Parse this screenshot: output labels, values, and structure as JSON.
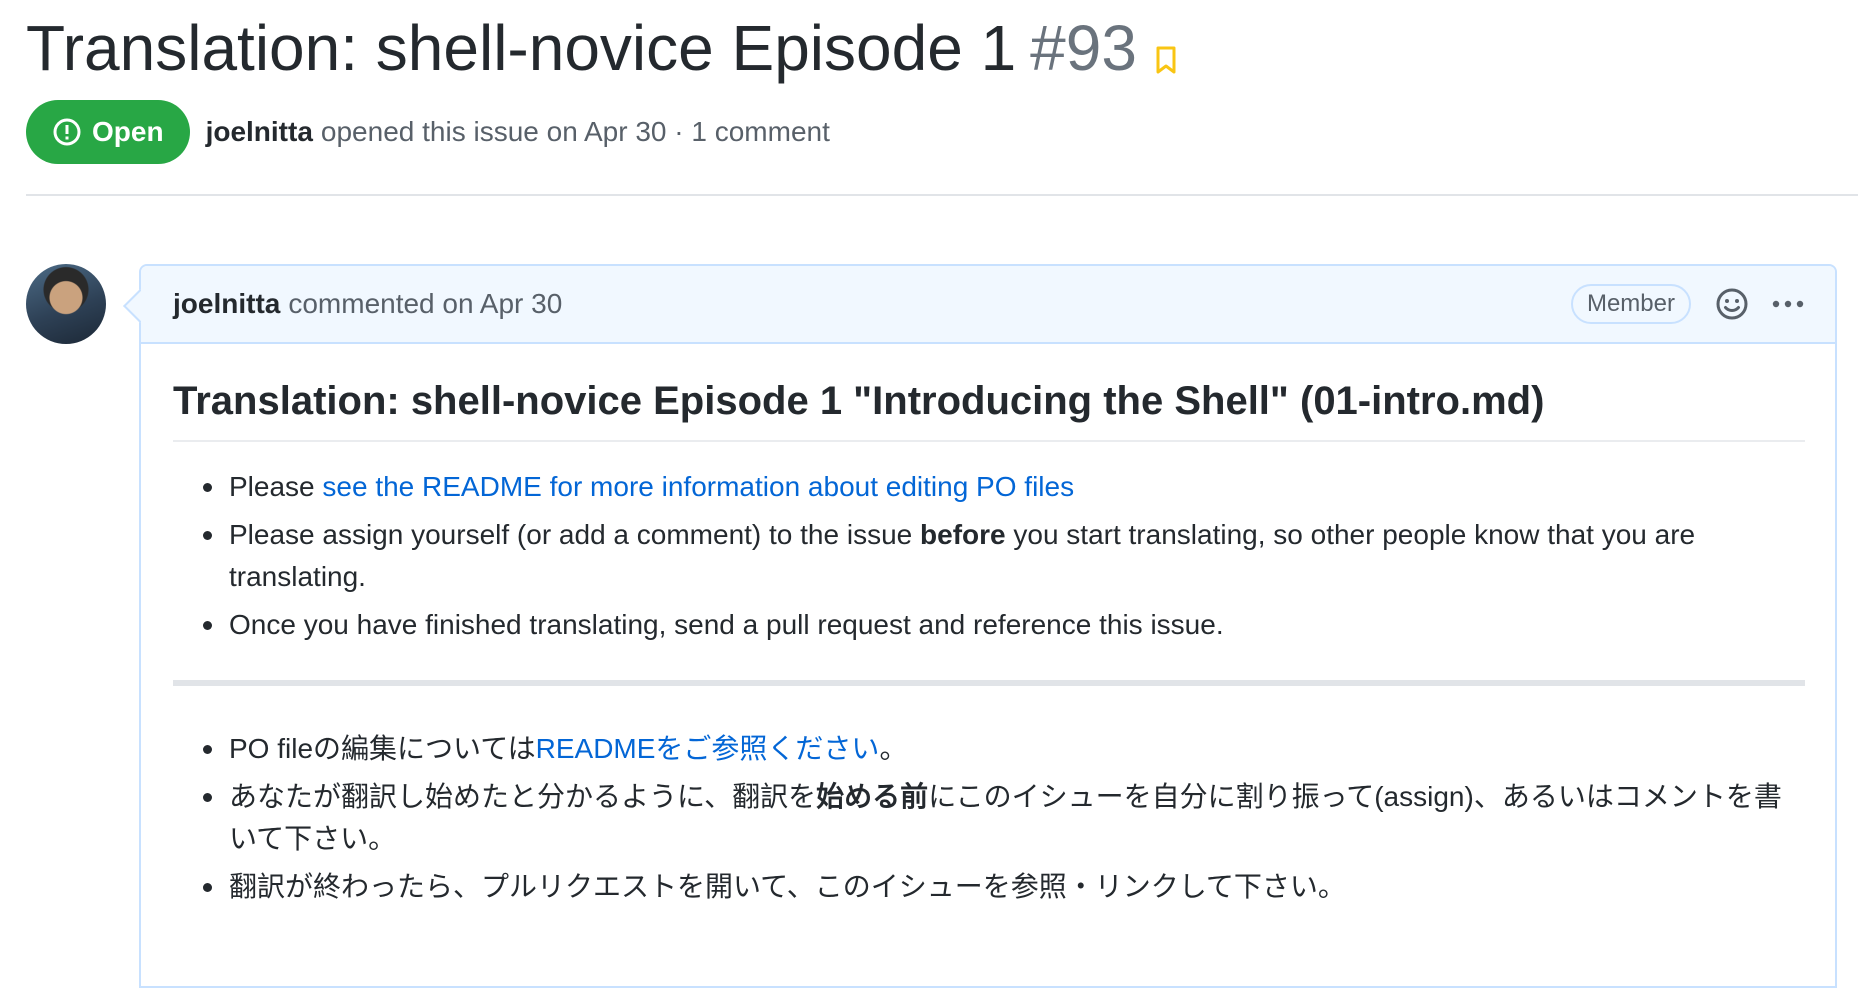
{
  "issue": {
    "title": "Translation: shell-novice Episode 1",
    "number": "#93",
    "state": "Open",
    "author": "joelnitta",
    "meta_text": "opened this issue on Apr 30 · 1 comment"
  },
  "comment": {
    "author": "joelnitta",
    "meta_text": "commented on Apr 30",
    "role": "Member",
    "heading": "Translation: shell-novice Episode 1 \"Introducing the Shell\" (01-intro.md)",
    "en": {
      "item1_prefix": "Please ",
      "item1_link": "see the README for more information about editing PO files",
      "item2_before": "Please assign yourself (or add a comment) to the issue ",
      "item2_bold": "before",
      "item2_after": " you start translating, so other people know that you are translating.",
      "item3": "Once you have finished translating, send a pull request and reference this issue."
    },
    "ja": {
      "item1_prefix": "PO fileの編集については",
      "item1_link": "READMEをご参照ください",
      "item1_suffix": "。",
      "item2_before": "あなたが翻訳し始めたと分かるように、翻訳を",
      "item2_bold": "始める前",
      "item2_after": "にこのイシューを自分に割り振って(assign)、あるいはコメントを書いて下さい。",
      "item3": "翻訳が終わったら、プルリクエストを開いて、このイシューを参照・リンクして下さい。"
    }
  },
  "colors": {
    "open_green": "#28a745",
    "link_blue": "#0366d6",
    "header_blue": "#f1f8ff",
    "bookmark_orange": "#f9c513"
  },
  "icons": [
    "issue-opened-icon",
    "bookmark-icon",
    "smiley-icon",
    "kebab-horizontal-icon"
  ]
}
